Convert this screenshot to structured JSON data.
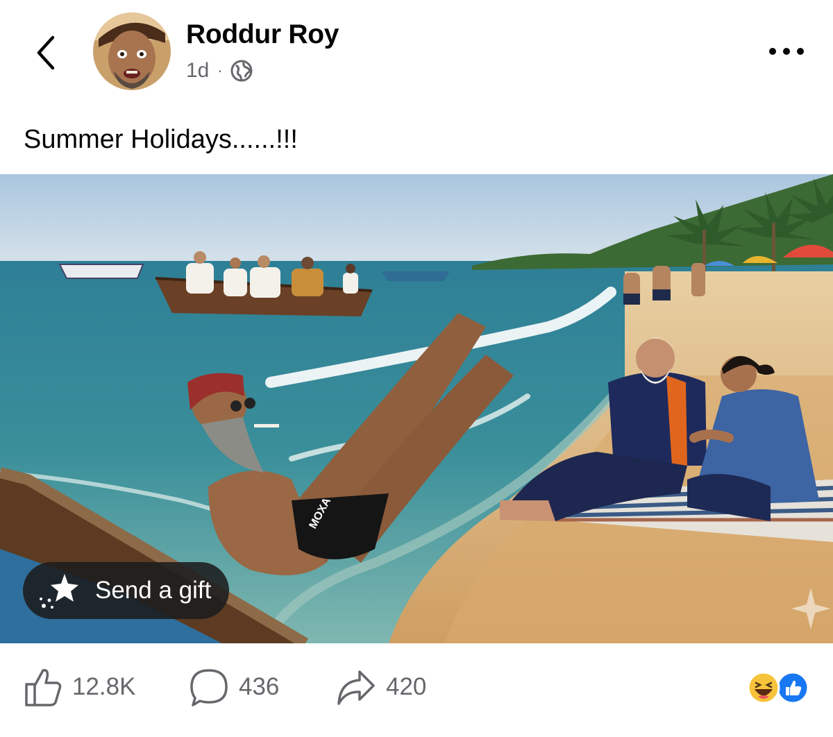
{
  "post": {
    "author": "Roddur Roy",
    "time": "1d",
    "separator": "·",
    "audience_icon": "globe-icon",
    "caption": "Summer Holidays......!!!"
  },
  "media": {
    "gift_label": "Send a gift",
    "gift_icon": "gift-sparkle-icon",
    "shorts_brand_text": "MOXA"
  },
  "actions": {
    "like_count": "12.8K",
    "comment_count": "436",
    "share_count": "420",
    "reaction_icons": [
      "haha-icon",
      "like-icon"
    ]
  },
  "colors": {
    "like_blue": "#1877f2",
    "secondary_text": "#65676b"
  }
}
